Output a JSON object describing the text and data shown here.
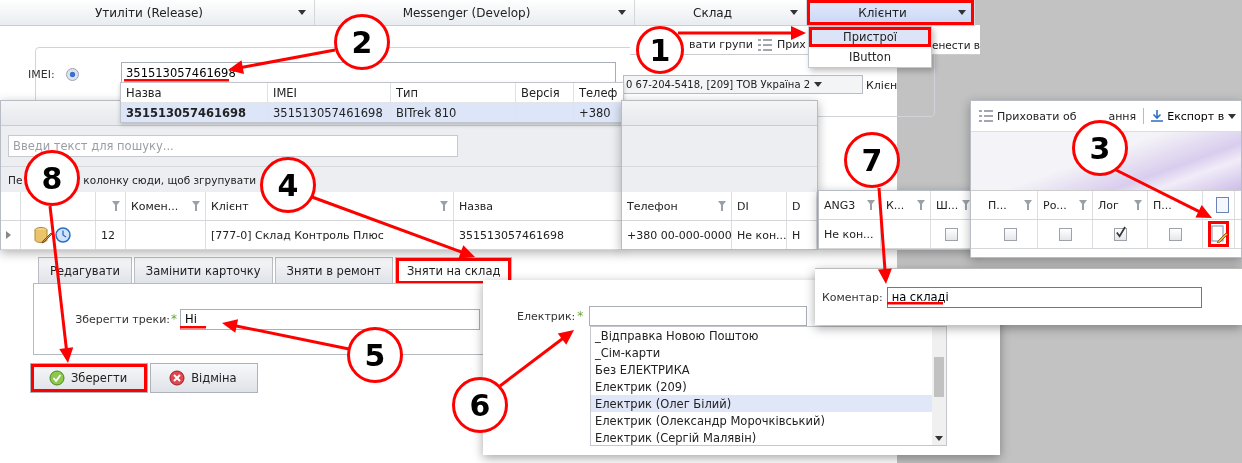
{
  "menubar": [
    {
      "label": "Утиліти (Release)",
      "selected": false,
      "highlighted": false
    },
    {
      "label": "Messenger (Develop)",
      "selected": false,
      "highlighted": false
    },
    {
      "label": "Склад",
      "selected": false,
      "highlighted": false
    },
    {
      "label": "Клієнти",
      "selected": true,
      "highlighted": true
    }
  ],
  "clients_menu": [
    {
      "label": "Пристрої",
      "selected": true,
      "highlighted": true
    },
    {
      "label": "IButton",
      "selected": false,
      "highlighted": false
    }
  ],
  "toolbar_behind": {
    "group_text": "вати групи",
    "hide_text": "Прих",
    "move_text": "енести в"
  },
  "imei_filter": {
    "label": "IMEI:",
    "value": "351513057461698",
    "underlined": true,
    "client_value": "0 67-204-5418, [209] ТОВ Україна 2",
    "client_label": "Клієн"
  },
  "autocomplete": {
    "columns": [
      "Назва",
      "IMEI",
      "Тип",
      "Версія",
      "Телеф"
    ],
    "rows": [
      {
        "name": "351513057461698",
        "imei": "351513057461698",
        "type": "BITrek 810",
        "phone": "+380",
        "selected": true
      }
    ]
  },
  "device_grid": {
    "search_placeholder": "Введи текст для пошуку...",
    "group_hint": [
      "Пе",
      "колонку сюди, щоб згрупувати"
    ]
  },
  "grids": [
    {
      "columns": [
        {
          "kind": "blank"
        },
        {
          "kind": "blank"
        },
        {
          "kind": "filter"
        },
        {
          "kind": "text",
          "label": "Комен...",
          "filter": true
        },
        {
          "kind": "text",
          "label": "Клієнт",
          "filter": true
        },
        {
          "kind": "text",
          "label": "Назва",
          "filter": false
        }
      ],
      "cells": [
        {
          "kind": "expander"
        },
        {
          "kind": "icons"
        },
        {
          "kind": "text",
          "text": "12"
        },
        {
          "kind": "empty"
        },
        {
          "kind": "text",
          "text": "[777-0] Склад Контроль Плюс"
        },
        {
          "kind": "text",
          "text": "351513057461698"
        }
      ]
    },
    {
      "columns": [
        {
          "kind": "text",
          "label": "Телефон",
          "filter": true
        },
        {
          "kind": "text",
          "label": "DI",
          "filter": false
        },
        {
          "kind": "text",
          "label": "D",
          "filter": false
        }
      ],
      "cells": [
        {
          "kind": "text",
          "text": "+380 00-000-0000"
        },
        {
          "kind": "text",
          "text": "Не кон..."
        },
        {
          "kind": "text",
          "text": "Н"
        }
      ]
    },
    {
      "columns": [
        {
          "kind": "text",
          "label": "ANG3",
          "filter": true
        },
        {
          "kind": "text",
          "label": "К...",
          "filter": true
        },
        {
          "kind": "text",
          "label": "Ш...",
          "filter": true
        }
      ],
      "cells": [
        {
          "kind": "text",
          "text": "Не кон..."
        },
        {
          "kind": "empty"
        },
        {
          "kind": "checkbox",
          "checked": false
        }
      ]
    },
    {
      "columns": [
        {
          "kind": "text",
          "label": "П...",
          "filter": true
        },
        {
          "kind": "text",
          "label": "Ро...",
          "filter": true
        },
        {
          "kind": "text",
          "label": "Лог",
          "filter": true
        },
        {
          "kind": "text",
          "label": "П...",
          "filter": false
        },
        {
          "kind": "select"
        }
      ],
      "cells": [
        {
          "kind": "checkbox",
          "checked": false
        },
        {
          "kind": "checkbox",
          "checked": false
        },
        {
          "kind": "checkbox",
          "checked": true
        },
        {
          "kind": "checkbox",
          "checked": false
        },
        {
          "kind": "edit",
          "highlighted": true
        }
      ]
    }
  ],
  "export_toolbar": {
    "hide_parts": [
      "Приховати об",
      "ання"
    ],
    "export_label": "Експорт в"
  },
  "tabs": [
    {
      "label": "Редагувати",
      "selected": false,
      "highlighted": false
    },
    {
      "label": "Замінити карточку",
      "selected": false,
      "highlighted": false
    },
    {
      "label": "Зняти в ремонт",
      "selected": false,
      "highlighted": false
    },
    {
      "label": "Зняти на склад",
      "selected": true,
      "highlighted": true
    }
  ],
  "save_tracks": {
    "label": "Зберегти треки:",
    "required_mark": "*",
    "value": "Ні",
    "underlined": true
  },
  "buttons": [
    {
      "kind": "save",
      "label": "Зберегти",
      "highlighted": true
    },
    {
      "kind": "cancel",
      "label": "Відміна",
      "highlighted": false
    }
  ],
  "electrician": {
    "label": "Електрик:",
    "required_mark": "*",
    "options": [
      {
        "label": "_Відправка Новою Поштою",
        "selected": false
      },
      {
        "label": "_Сім-карти",
        "selected": false
      },
      {
        "label": "Без ЕЛЕКТРИКА",
        "selected": false
      },
      {
        "label": "Електрик (209)",
        "selected": false
      },
      {
        "label": "Електрик (Олег Білий)",
        "selected": true
      },
      {
        "label": "Електрик (Олександр Морочківський)",
        "selected": false
      },
      {
        "label": "Електрик (Сергій Малявін)",
        "selected": false
      }
    ]
  },
  "comment": {
    "label": "Коментар:",
    "value": "на складі",
    "underlined": true
  },
  "callouts": [
    {
      "number": "2"
    },
    {
      "number": "1"
    },
    {
      "number": "8"
    },
    {
      "number": "4"
    },
    {
      "number": "7"
    },
    {
      "number": "3"
    },
    {
      "number": "5"
    },
    {
      "number": "6"
    }
  ]
}
